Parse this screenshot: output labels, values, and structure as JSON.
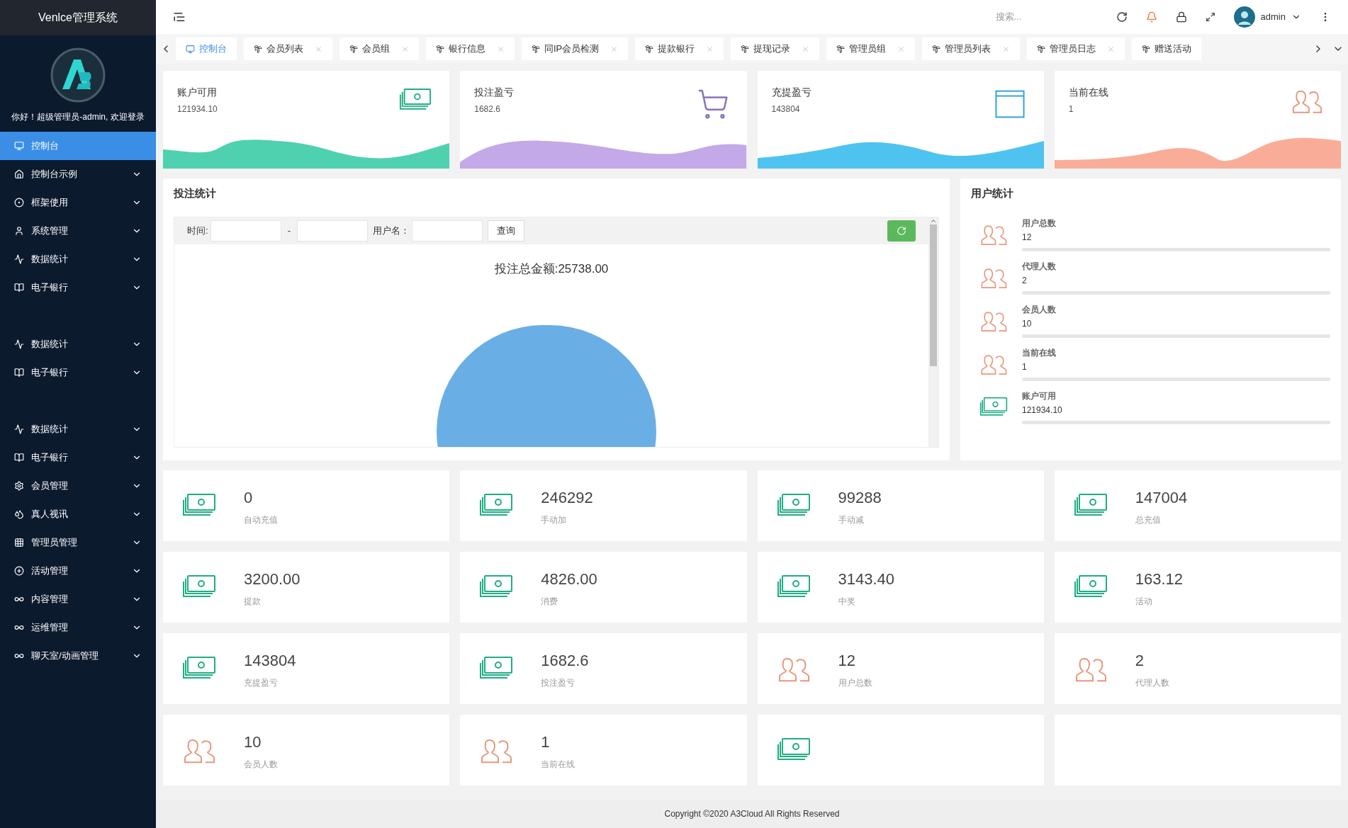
{
  "sidebar": {
    "title": "Venlce管理系统",
    "greeting": "你好！超级管理员-admin, 欢迎登录",
    "groups": [
      [
        {
          "label": "控制台",
          "selected": true,
          "expandable": false
        },
        {
          "label": "控制台示例",
          "selected": false,
          "expandable": true
        },
        {
          "label": "框架使用",
          "selected": false,
          "expandable": true
        },
        {
          "label": "系统管理",
          "selected": false,
          "expandable": true
        },
        {
          "label": "数据统计",
          "selected": false,
          "expandable": true
        },
        {
          "label": "电子银行",
          "selected": false,
          "expandable": true
        }
      ],
      [
        {
          "label": "数据统计",
          "selected": false,
          "expandable": true
        },
        {
          "label": "电子银行",
          "selected": false,
          "expandable": true
        }
      ],
      [
        {
          "label": "数据统计",
          "selected": false,
          "expandable": true
        },
        {
          "label": "电子银行",
          "selected": false,
          "expandable": true
        },
        {
          "label": "会员管理",
          "selected": false,
          "expandable": true
        },
        {
          "label": "真人视讯",
          "selected": false,
          "expandable": true
        },
        {
          "label": "管理员管理",
          "selected": false,
          "expandable": true
        },
        {
          "label": "活动管理",
          "selected": false,
          "expandable": true
        },
        {
          "label": "内容管理",
          "selected": false,
          "expandable": true
        },
        {
          "label": "运维管理",
          "selected": false,
          "expandable": true
        },
        {
          "label": "聊天室/动画管理",
          "selected": false,
          "expandable": true
        }
      ]
    ]
  },
  "topbar": {
    "search": {
      "placeholder": "搜索..."
    },
    "user": "admin"
  },
  "tabs": [
    {
      "label": "控制台",
      "selected": true,
      "closable": false
    },
    {
      "label": "会员列表",
      "selected": false,
      "closable": true
    },
    {
      "label": "会员组",
      "selected": false,
      "closable": true
    },
    {
      "label": "银行信息",
      "selected": false,
      "closable": true
    },
    {
      "label": "同IP会员检测",
      "selected": false,
      "closable": true
    },
    {
      "label": "提款银行",
      "selected": false,
      "closable": true
    },
    {
      "label": "提现记录",
      "selected": false,
      "closable": true
    },
    {
      "label": "管理员组",
      "selected": false,
      "closable": true
    },
    {
      "label": "管理员列表",
      "selected": false,
      "closable": true
    },
    {
      "label": "管理员日志",
      "selected": false,
      "closable": true
    },
    {
      "label": "赠送活动",
      "selected": false,
      "closable": false
    }
  ],
  "summary_cards": [
    {
      "title": "账户可用",
      "value": "121934.10",
      "kind": "money",
      "color": "#4fd1b0"
    },
    {
      "title": "投注盈亏",
      "value": "1682.6",
      "kind": "cart",
      "color": "#c3a9e8"
    },
    {
      "title": "充提盈亏",
      "value": "143804",
      "kind": "window",
      "color": "#4fc3f0"
    },
    {
      "title": "当前在线",
      "value": "1",
      "kind": "users",
      "color": "#f9ad98"
    }
  ],
  "bet_stats": {
    "title": "投注统计",
    "time_label": "时间:",
    "separator": "-",
    "user_label": "用户名：",
    "query_button": "查询",
    "total": "投注总金额:25738.00"
  },
  "user_stats": {
    "title": "用户统计",
    "items": [
      {
        "label": "用户总数",
        "value": "12",
        "kind": "users"
      },
      {
        "label": "代理人数",
        "value": "2",
        "kind": "users"
      },
      {
        "label": "会员人数",
        "value": "10",
        "kind": "users"
      },
      {
        "label": "当前在线",
        "value": "1",
        "kind": "users"
      },
      {
        "label": "账户可用",
        "value": "121934.10",
        "kind": "money"
      }
    ]
  },
  "stat_cards": [
    {
      "value": "0",
      "label": "自动充值",
      "kind": "money"
    },
    {
      "value": "246292",
      "label": "手动加",
      "kind": "money"
    },
    {
      "value": "99288",
      "label": "手动减",
      "kind": "money"
    },
    {
      "value": "147004",
      "label": "总充值",
      "kind": "money"
    },
    {
      "value": "3200.00",
      "label": "提款",
      "kind": "money"
    },
    {
      "value": "4826.00",
      "label": "消费",
      "kind": "money"
    },
    {
      "value": "3143.40",
      "label": "中奖",
      "kind": "money"
    },
    {
      "value": "163.12",
      "label": "活动",
      "kind": "money"
    },
    {
      "value": "143804",
      "label": "充提盈亏",
      "kind": "money"
    },
    {
      "value": "1682.6",
      "label": "投注盈亏",
      "kind": "money"
    },
    {
      "value": "12",
      "label": "用户总数",
      "kind": "users"
    },
    {
      "value": "2",
      "label": "代理人数",
      "kind": "users"
    },
    {
      "value": "10",
      "label": "会员人数",
      "kind": "users"
    },
    {
      "value": "1",
      "label": "当前在线",
      "kind": "users"
    },
    {
      "kind": "money"
    },
    {
      "kind": "blank"
    }
  ],
  "footer": "Copyright ©2020 A3Cloud All Rights Reserved"
}
